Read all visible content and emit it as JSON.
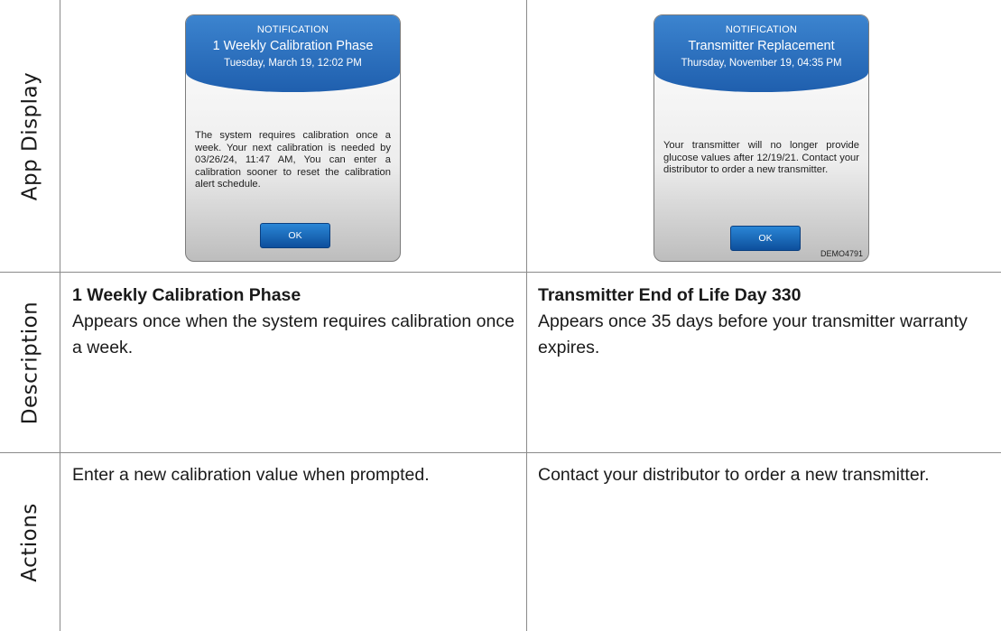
{
  "row_labels": {
    "app_display": "App Display",
    "description": "Description",
    "actions": "Actions"
  },
  "left": {
    "dialog": {
      "kicker": "NOTIFICATION",
      "title": "1 Weekly Calibration Phase",
      "date": "Tuesday, March 19, 12:02 PM",
      "body": "The system requires calibration once a week. Your next calibration is needed by 03/26/24, 11:47 AM, You can enter a calibration sooner to reset the calibration alert schedule.",
      "ok_label": "OK"
    },
    "description_title": "1 Weekly Calibration Phase",
    "description_text": "Appears once when the system requires calibration once a week.",
    "actions_text": "Enter a new calibration value when prompted."
  },
  "right": {
    "dialog": {
      "kicker": "NOTIFICATION",
      "title": "Transmitter Replacement",
      "date": "Thursday, November 19, 04:35 PM",
      "body": "Your transmitter will no longer provide glucose values after 12/19/21. Contact your distributor to order a new transmitter.",
      "ok_label": "OK",
      "code": "DEMO4791"
    },
    "description_title": "Transmitter End of Life Day 330",
    "description_text": "Appears once 35 days before your transmitter warranty expires.",
    "actions_text": "Contact your distributor to order a new transmitter."
  }
}
